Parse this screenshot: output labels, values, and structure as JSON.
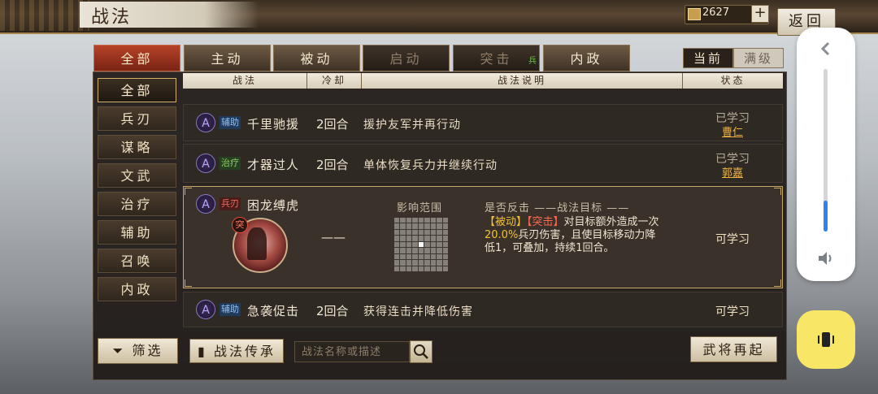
{
  "header": {
    "title": "战法",
    "coins": "2627",
    "plus_label": "+",
    "back_label": "返回"
  },
  "tabs": [
    {
      "label": "全部",
      "state": "active"
    },
    {
      "label": "主动",
      "state": "normal"
    },
    {
      "label": "被动",
      "state": "normal"
    },
    {
      "label": "启动",
      "state": "dim"
    },
    {
      "label": "突击",
      "state": "dim"
    },
    {
      "label": "内政",
      "state": "normal"
    }
  ],
  "tab_badge": "兵",
  "view_toggle": {
    "current": "当前",
    "max": "满级"
  },
  "sidebar": {
    "items": [
      "全部",
      "兵刃",
      "谋略",
      "文武",
      "治疗",
      "辅助",
      "召唤",
      "内政"
    ],
    "active_index": 0
  },
  "filter_label": "筛选",
  "table": {
    "headers": {
      "name": "战法",
      "cooldown": "冷却",
      "desc": "战法说明",
      "status": "状态"
    },
    "rows": [
      {
        "type": "辅助",
        "name": "千里驰援",
        "cooldown": "2回合",
        "desc": "援护友军并再行动",
        "status": "已学习",
        "learner": "曹仁"
      },
      {
        "type": "治疗",
        "name": "才器过人",
        "cooldown": "2回合",
        "desc": "单体恢复兵力并继续行动",
        "status": "已学习",
        "learner": "郭嘉"
      },
      {
        "type": "辅助",
        "name": "急袭促击",
        "cooldown": "2回合",
        "desc": "获得连击并降低伤害",
        "status": "可学习"
      }
    ],
    "expanded": {
      "type": "兵刃",
      "name": "困龙缚虎",
      "badge": "突",
      "cooldown": "——",
      "range_label": "影响范围",
      "header_line": "是否反击 ——战法目标 ——",
      "desc_prefix_a": "【被动】",
      "desc_prefix_b": "【突击】",
      "desc_line1_rest": "对目标额外造成一次",
      "desc_percent": "20.0%",
      "desc_line2_rest": "兵刃伤害，且使目标移动力降",
      "desc_line3": "低1，可叠加，持续1回合。",
      "status": "可学习"
    }
  },
  "footer": {
    "inherit_label": "战法传承",
    "search_placeholder": "战法名称或描述",
    "rise_label": "武将再起"
  },
  "volume": {
    "level_fraction": 0.19
  }
}
